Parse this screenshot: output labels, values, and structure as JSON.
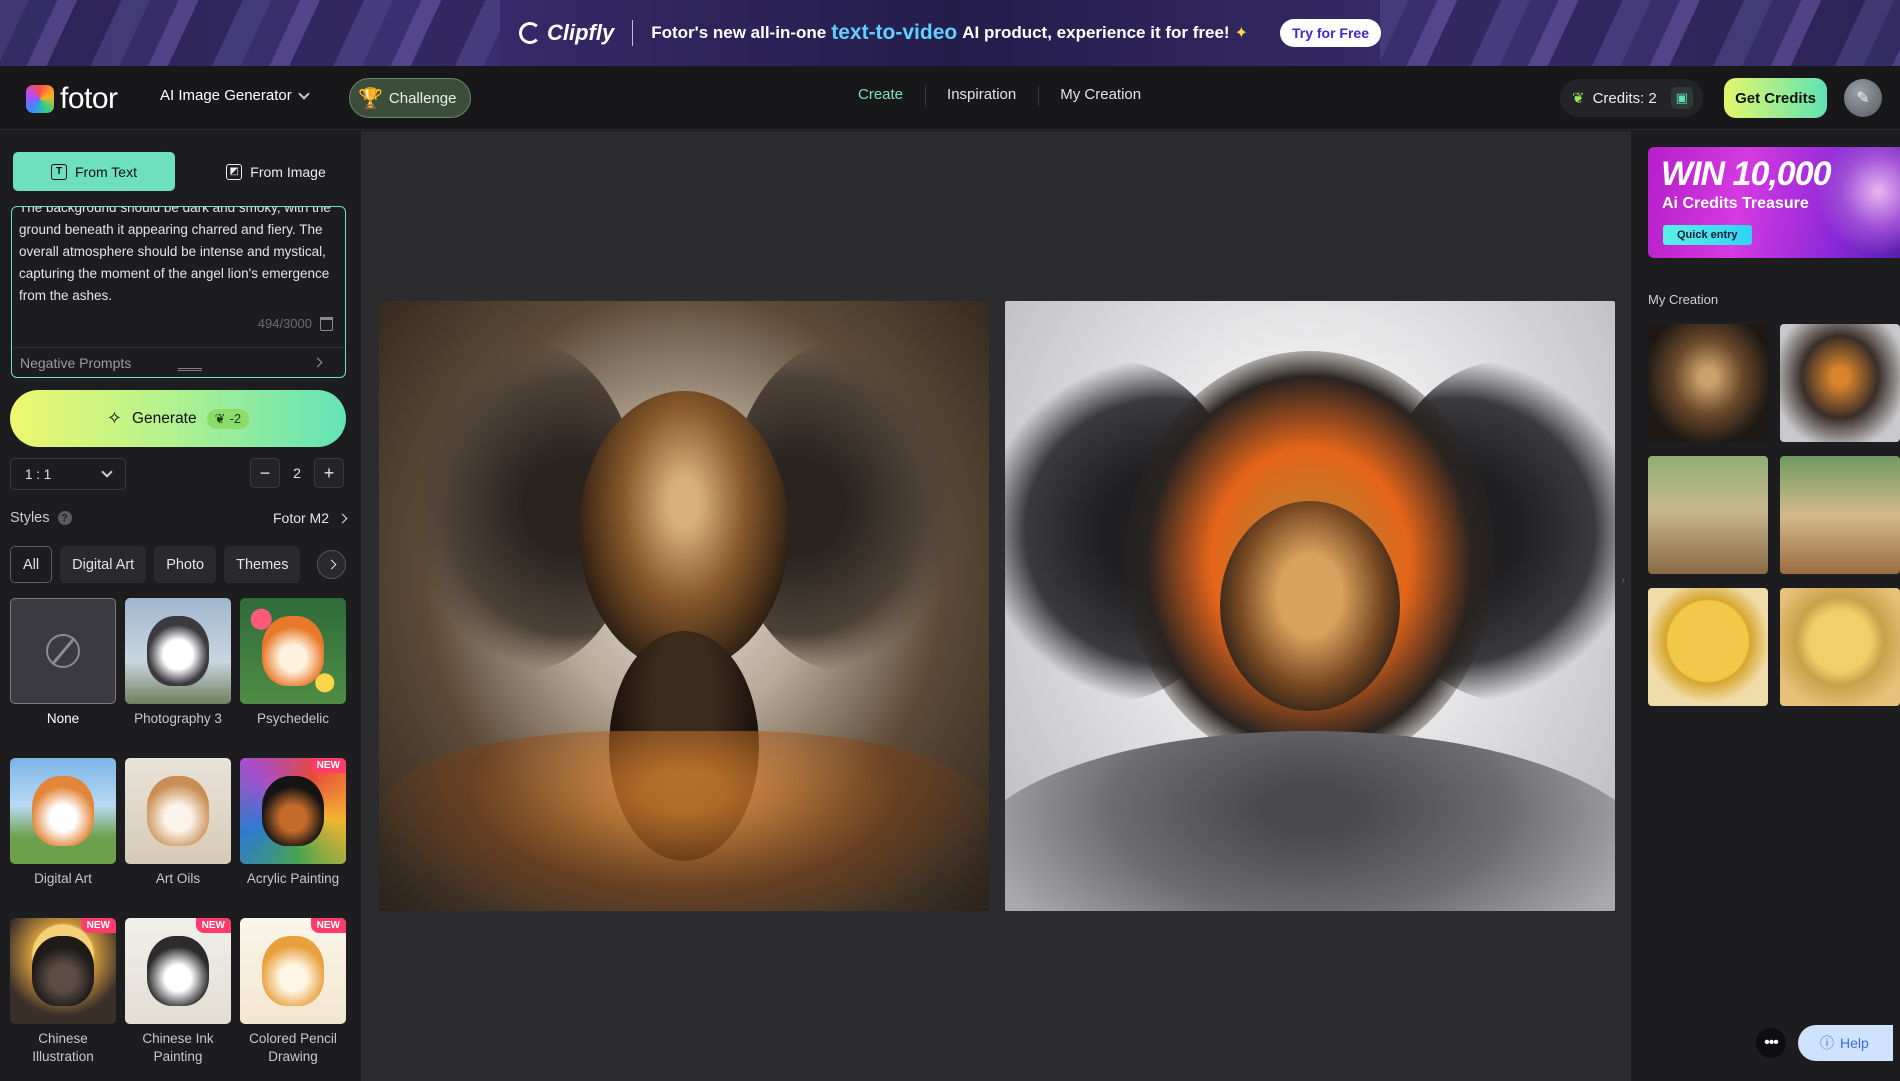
{
  "banner": {
    "brand": "Clipfly",
    "text_before": "Fotor's new all-in-one",
    "text_highlight": "text-to-video",
    "text_after": "AI product, experience it for free!",
    "cta": "Try for Free"
  },
  "nav": {
    "logo": "fotor",
    "tool": "AI Image Generator",
    "challenge": "Challenge",
    "tabs": [
      "Create",
      "Inspiration",
      "My Creation"
    ],
    "active_tab": "Create",
    "credits": "Credits: 2",
    "get_credits": "Get Credits"
  },
  "left": {
    "mode_tabs": [
      "From Text",
      "From Image"
    ],
    "active_mode": "From Text",
    "prompt_text": "The background should be dark and smoky, with the ground beneath it appearing charred and fiery. The overall atmosphere should be intense and mystical, capturing the moment of the angel lion's emergence from the ashes.",
    "char_count": "494/3000",
    "negative_prompts": "Negative Prompts",
    "generate": "Generate",
    "generate_cost": "-2",
    "ratio": "1 : 1",
    "count": "2",
    "styles_label": "Styles",
    "model": "Fotor M2",
    "categories": [
      "All",
      "Digital Art",
      "Photo",
      "Themes"
    ],
    "active_category": "All",
    "styles": [
      {
        "label": "None",
        "new": false
      },
      {
        "label": "Photography 3",
        "new": false
      },
      {
        "label": "Psychedelic",
        "new": false
      },
      {
        "label": "Digital Art",
        "new": false
      },
      {
        "label": "Art Oils",
        "new": false
      },
      {
        "label": "Acrylic Painting",
        "new": true
      },
      {
        "label": "Chinese Illustration",
        "new": true
      },
      {
        "label": "Chinese Ink Painting",
        "new": true
      },
      {
        "label": "Colored Pencil Drawing",
        "new": true
      }
    ],
    "new_badge": "NEW"
  },
  "right": {
    "promo_title": "WIN 10,000",
    "promo_sub": "Ai Credits Treasure",
    "promo_btn": "Quick entry",
    "my_creation_title": "My Creation"
  },
  "help": "Help",
  "colors": {
    "accent": "#6fe0bd",
    "background": "#1c1c1e",
    "canvas": "#2c2c2f",
    "new_badge": "#ff3b6b"
  },
  "icons": [
    "trophy-icon",
    "leaf-icon",
    "gift-icon",
    "avatar-icon",
    "text-icon",
    "image-icon",
    "trash-icon",
    "wand-icon",
    "help-icon",
    "no-style-icon",
    "chevron-right-icon",
    "more-icon"
  ]
}
